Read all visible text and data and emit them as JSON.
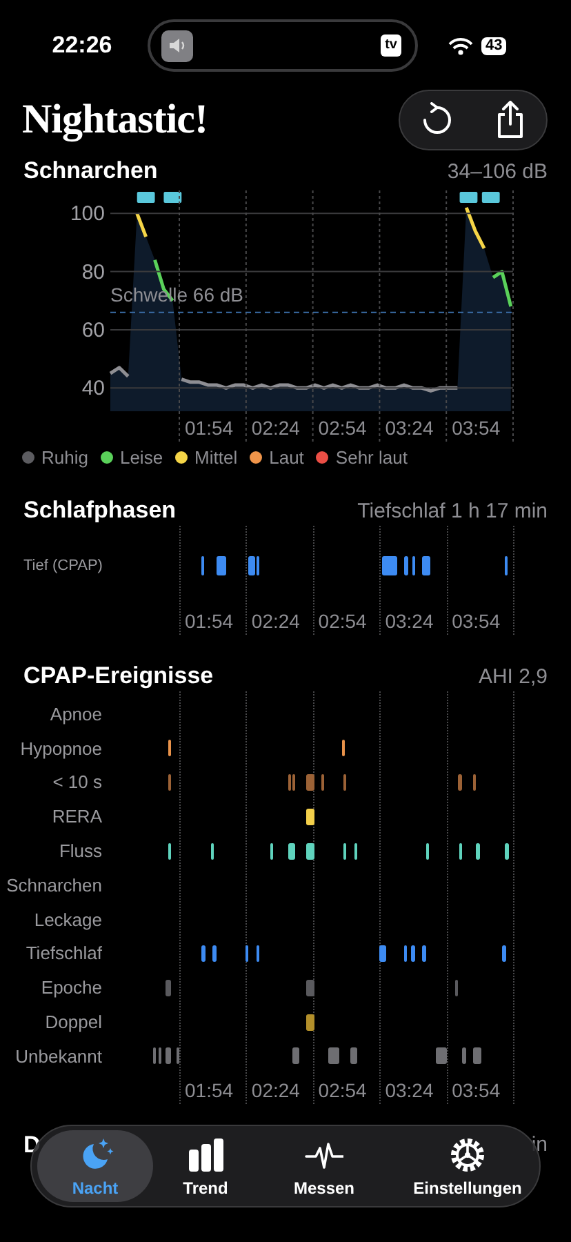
{
  "status_bar": {
    "time": "22:26",
    "tv_badge": "tv",
    "battery": "43"
  },
  "header": {
    "title": "Nightastic!"
  },
  "snoring": {
    "title": "Schnarchen",
    "range": "34–106 dB",
    "y_labels": [
      "100",
      "80",
      "60",
      "40"
    ],
    "threshold_label": "Schwelle 66 dB",
    "time_labels": [
      "01:54",
      "02:24",
      "02:54",
      "03:24",
      "03:54"
    ],
    "legend": [
      {
        "label": "Ruhig",
        "color": "#5c5c60"
      },
      {
        "label": "Leise",
        "color": "#5ad15a"
      },
      {
        "label": "Mittel",
        "color": "#f5d547"
      },
      {
        "label": "Laut",
        "color": "#f0954a"
      },
      {
        "label": "Sehr laut",
        "color": "#eb4e45"
      }
    ]
  },
  "sleep_phases": {
    "title": "Schlafphasen",
    "summary": "Tiefschlaf 1 h 17 min",
    "time_labels": [
      "01:54",
      "02:24",
      "02:54",
      "03:24",
      "03:54"
    ],
    "rows": [
      {
        "label": "Tief (CPAP)",
        "color": "#3d8bf2"
      }
    ]
  },
  "cpap_events": {
    "title": "CPAP-Ereignisse",
    "summary": "AHI 2,9",
    "time_labels": [
      "01:54",
      "02:24",
      "02:54",
      "03:24",
      "03:54"
    ],
    "rows": [
      {
        "label": "Apnoe"
      },
      {
        "label": "Hypopnoe",
        "color": "#e8924a"
      },
      {
        "label": "< 10 s",
        "color": "#9c6236"
      },
      {
        "label": "RERA",
        "color": "#f3cf4a"
      },
      {
        "label": "Fluss",
        "color": "#5fd3bd"
      },
      {
        "label": "Schnarchen"
      },
      {
        "label": "Leckage"
      },
      {
        "label": "Tiefschlaf",
        "color": "#3d8bf2"
      },
      {
        "label": "Epoche",
        "color": "#5a5a5e"
      },
      {
        "label": "Doppel",
        "color": "#b38f2a"
      },
      {
        "label": "Unbekannt",
        "color": "#6e6e72"
      }
    ]
  },
  "next_section": {
    "title": "D",
    "summary": "in"
  },
  "tab_bar": [
    {
      "label": "Nacht",
      "selected": true
    },
    {
      "label": "Trend",
      "selected": false
    },
    {
      "label": "Messen",
      "selected": false
    },
    {
      "label": "Einstellungen",
      "selected": false
    }
  ]
}
